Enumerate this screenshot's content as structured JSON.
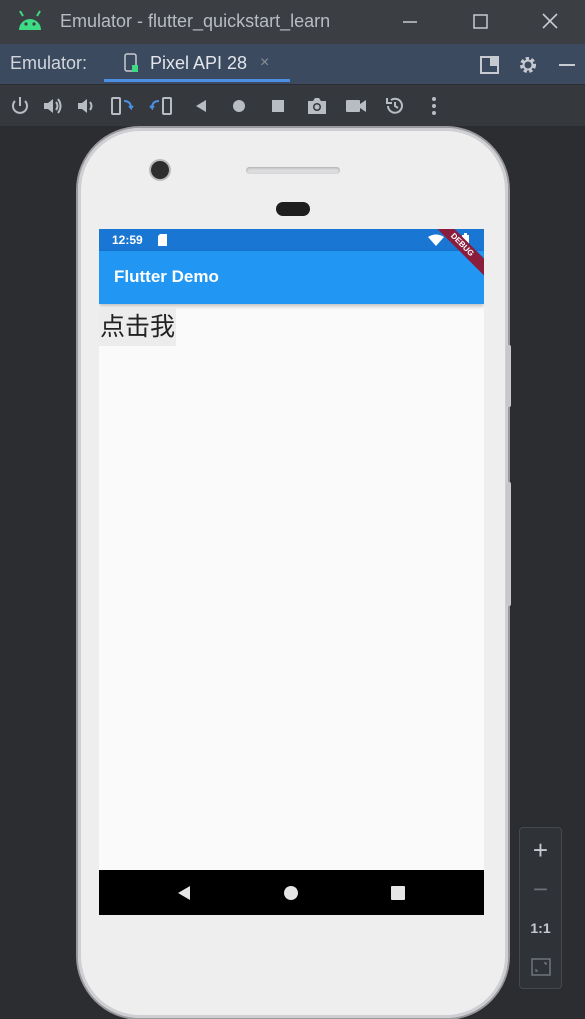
{
  "window": {
    "title": "Emulator - flutter_quickstart_learn",
    "app_icon": "android-icon",
    "controls": [
      "minimize-icon",
      "maximize-icon",
      "close-icon"
    ]
  },
  "tabbar": {
    "label": "Emulator:",
    "tab": {
      "label": "Pixel API 28",
      "close": "×",
      "icon": "device-icon"
    },
    "accent": "#4a8fe2"
  },
  "toolbar": {
    "icons": [
      "power-icon",
      "volume-up-icon",
      "volume-down-icon",
      "rotate-left-icon",
      "rotate-right-icon",
      "back-icon",
      "home-icon",
      "overview-icon",
      "screenshot-icon",
      "screenrecord-icon",
      "snapshot-icon",
      "more-icon"
    ]
  },
  "device": {
    "status_bar": {
      "time": "12:59",
      "color": "#1976d2"
    },
    "app_bar": {
      "title": "Flutter Demo",
      "color": "#2196f3"
    },
    "debug_banner": "DEBUG",
    "body": {
      "button_label": "点击我"
    },
    "nav_bar": [
      "back-icon",
      "home-icon",
      "recents-icon"
    ]
  },
  "zoom_panel": {
    "zoom_in": "+",
    "zoom_out": "−",
    "actual_size": "1:1",
    "fit_icon": "fit-screen-icon"
  }
}
